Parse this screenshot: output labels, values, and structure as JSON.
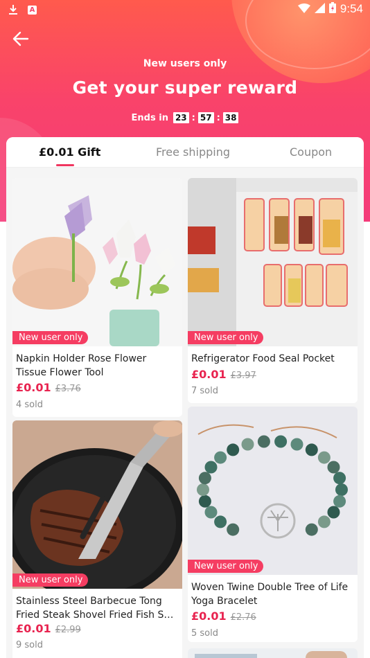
{
  "status_bar": {
    "time": "9:54"
  },
  "header": {
    "subtitle": "New users only",
    "title": "Get your super reward",
    "ends_label": "Ends in",
    "countdown": [
      "23",
      "57",
      "38"
    ]
  },
  "tabs": [
    {
      "label": "£0.01 Gift",
      "active": true
    },
    {
      "label": "Free shipping",
      "active": false
    },
    {
      "label": "Coupon",
      "active": false
    }
  ],
  "products": [
    {
      "badge": "New user only",
      "name": "Napkin Holder Rose Flower Tissue Flower Tool",
      "price": "£0.01",
      "old_price": "£3.76",
      "sold": "4 sold"
    },
    {
      "badge": "New user only",
      "name": "Refrigerator Food Seal Pocket",
      "price": "£0.01",
      "old_price": "£3.97",
      "sold": "7 sold"
    },
    {
      "badge": "New user only",
      "name": "Stainless Steel Barbecue Tong Fried Steak Shovel Fried Fish Shovel BBQ Clip",
      "price": "£0.01",
      "old_price": "£2.99",
      "sold": "9 sold"
    },
    {
      "badge": "New user only",
      "name": "Woven Twine Double Tree of Life Yoga Bracelet",
      "price": "£0.01",
      "old_price": "£2.76",
      "sold": "5 sold"
    }
  ],
  "colors": {
    "accent": "#f53d62",
    "price": "#e8234f"
  }
}
